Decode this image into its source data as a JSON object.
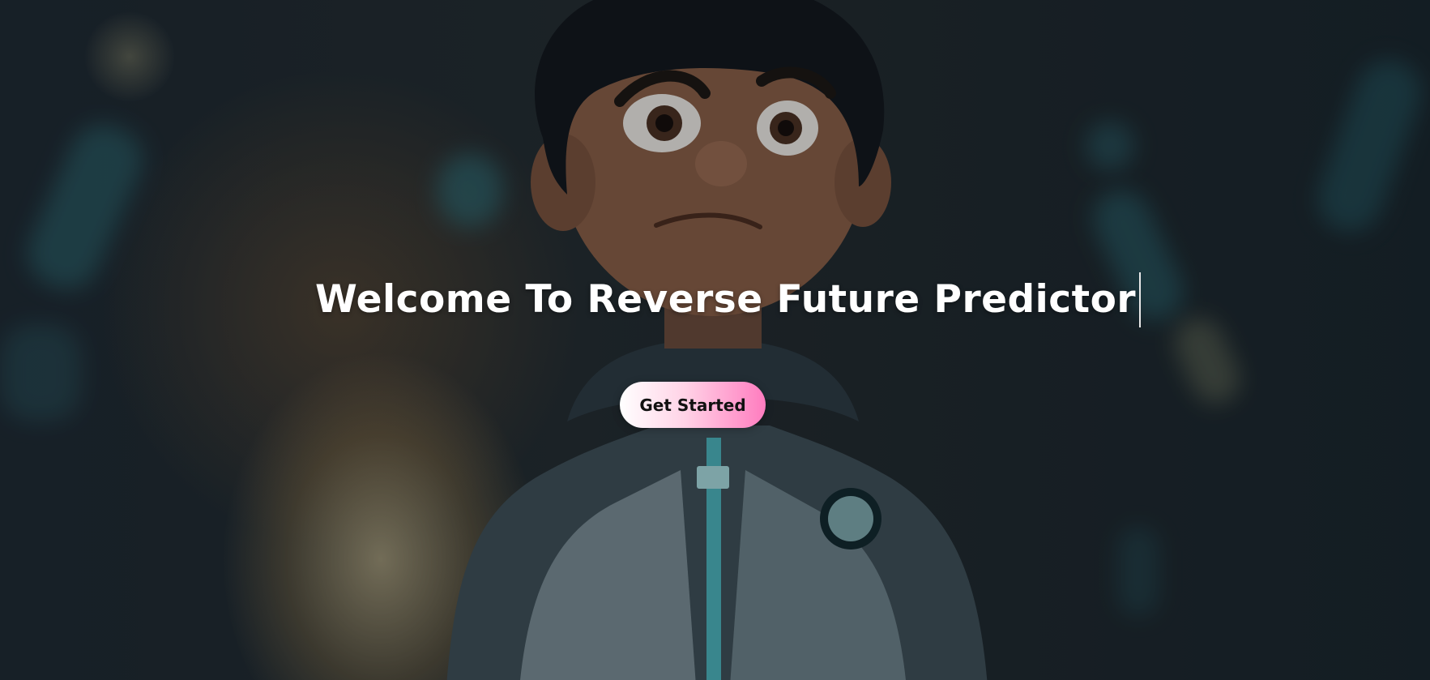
{
  "hero": {
    "title": "Welcome To Reverse Future Predictor",
    "cta_label": "Get Started",
    "background_image": "animated-boy-in-hoodie-illustration"
  },
  "colors": {
    "title_text": "#ffffff",
    "cta_gradient_start": "#ffffff",
    "cta_gradient_end": "#ff7cbf",
    "cta_text": "#111111"
  }
}
